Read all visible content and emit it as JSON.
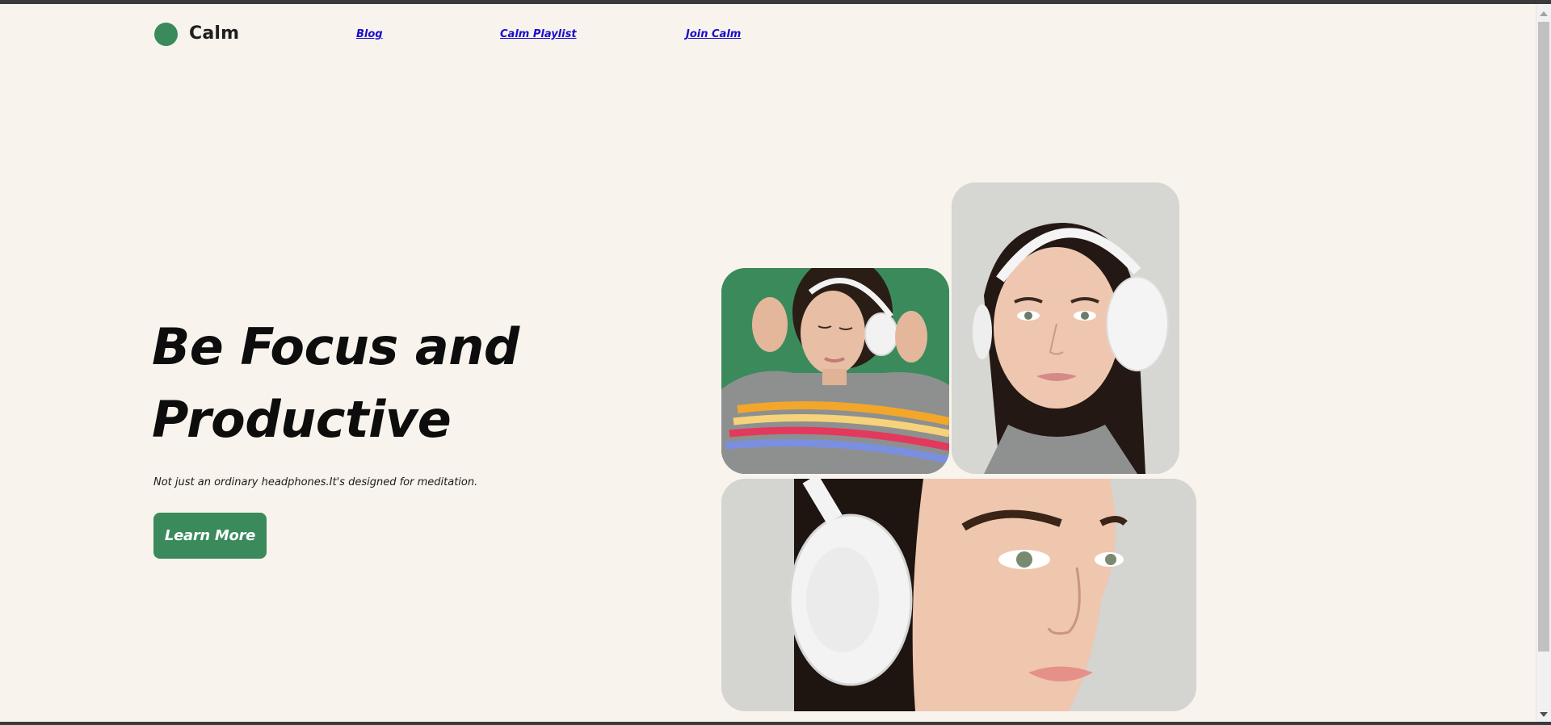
{
  "brand": {
    "name": "Calm",
    "accent_color": "#3a8a5c",
    "background_color": "#f8f3ec"
  },
  "nav": {
    "links": [
      "Blog",
      "Calm Playlist",
      "Join Calm"
    ]
  },
  "hero": {
    "title_line1": "Be Focus and",
    "title_line2": "Productive",
    "subtitle": "Not just an ordinary headphones.It's designed for meditation.",
    "cta_label": "Learn More"
  },
  "icons": {
    "logo": "green-circle-logo-icon",
    "scroll_up": "scroll-up-arrow-icon",
    "scroll_down": "scroll-down-arrow-icon"
  }
}
